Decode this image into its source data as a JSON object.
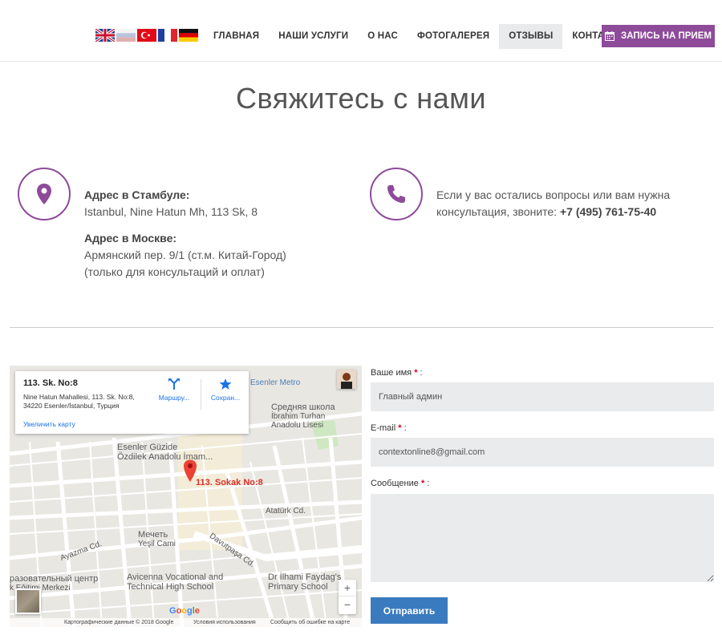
{
  "header": {
    "flags": [
      "gb-flag-icon",
      "ru-flag-icon",
      "tr-flag-icon",
      "fr-flag-icon",
      "de-flag-icon"
    ],
    "nav": [
      {
        "label": "ГЛАВНАЯ",
        "active": false
      },
      {
        "label": "НАШИ УСЛУГИ",
        "active": false
      },
      {
        "label": "О НАС",
        "active": false
      },
      {
        "label": "ФОТОГАЛЕРЕЯ",
        "active": false
      },
      {
        "label": "ОТЗЫВЫ",
        "active": true
      },
      {
        "label": "КОНТАКТЫ",
        "active": false
      }
    ],
    "appointment_label": "ЗАПИСЬ НА ПРИЕМ",
    "appointment_icon": "calendar-icon"
  },
  "page_title": "Свяжитесь с нами",
  "contacts": {
    "istanbul_heading": "Адрес в Стамбуле:",
    "istanbul_text": "Istanbul, Nine Hatun Mh, 113 Sk, 8",
    "moscow_heading": "Адрес в Москве:",
    "moscow_line1": "Армянский пер. 9/1 (ст.м. Китай-Город)",
    "moscow_line2": "(только для консультаций и оплат)",
    "phone_text_line1": "Если у вас остались вопросы или вам нужна",
    "phone_text_line2": "консультация, звоните:",
    "phone_number": "+7 (495) 761-75-40",
    "location_icon": "location-pin-icon",
    "phone_icon": "phone-icon"
  },
  "map": {
    "card_title": "113. Sk. No:8",
    "card_address_line1": "Nine Hatun Mahallesi, 113. Sk. No:8,",
    "card_address_line2": "34220 Esenler/İstanbul, Турция",
    "enlarge_link": "Увеличить карту",
    "route_label": "Маршру...",
    "save_label": "Сохран...",
    "marker_label": "113. Sokak No:8",
    "labels": {
      "metro": "Esenler Metro",
      "school_ru": "Средняя школа",
      "school_tr1": "İbrahim Turhan",
      "school_tr2": "Anadolu Lisesi",
      "guzide1": "Esenler Güzide",
      "guzide2": "Özdilek Anadolu İmam...",
      "mosque_ru": "Мечеть",
      "mosque_tr": "Yeşil Cami",
      "avicenna1": "Avicenna Vocational and",
      "avicenna2": "Technical High School",
      "ilhami1": "Dr İlhami Faydag's",
      "ilhami2": "Primary School",
      "edu1": "разовательный центр",
      "edu2": "k Eğitimi Merkezi",
      "davutpasa": "Davutpaşa Cd.",
      "ataturk": "Atatürk Cd.",
      "ayazma": "Ayazma Cd."
    },
    "footer_data": "Картографические данные © 2018 Google",
    "footer_terms": "Условия использования",
    "footer_report": "Сообщить об ошибке на карте",
    "google": "Google",
    "zoom_in": "+",
    "zoom_out": "−"
  },
  "form": {
    "name_label": "Ваше имя",
    "name_value": "Главный админ",
    "email_label": "E-mail",
    "email_value": "contextonline8@gmail.com",
    "message_label": "Сообщение",
    "message_value": "",
    "required_mark": "*",
    "label_suffix": " :",
    "submit_label": "Отправить"
  },
  "colors": {
    "accent": "#8e4b9a",
    "submit": "#3a7bbf",
    "field_bg": "#e9ebed"
  }
}
